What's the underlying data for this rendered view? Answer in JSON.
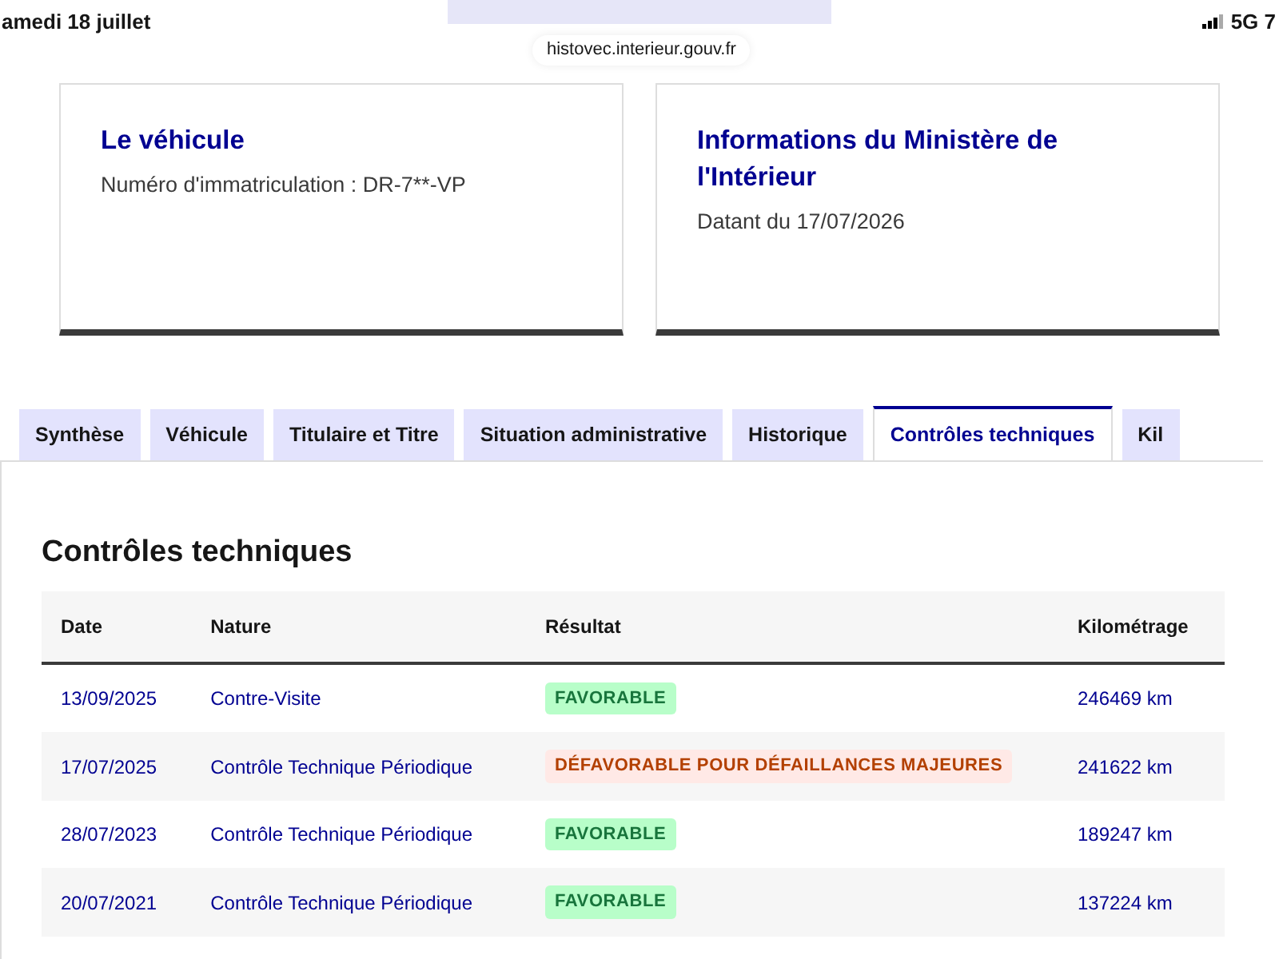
{
  "status_bar": {
    "date": "amedi 18 juillet",
    "network": "5G 7"
  },
  "url": "histovec.interieur.gouv.fr",
  "cards": [
    {
      "title": "Le véhicule",
      "text": "Numéro d'immatriculation : DR-7**-VP"
    },
    {
      "title": "Informations du Ministère de l'Intérieur",
      "text": "Datant du 17/07/2026"
    }
  ],
  "tabs": [
    {
      "label": "Synthèse",
      "selected": false
    },
    {
      "label": "Véhicule",
      "selected": false
    },
    {
      "label": "Titulaire et Titre",
      "selected": false
    },
    {
      "label": "Situation administrative",
      "selected": false
    },
    {
      "label": "Historique",
      "selected": false
    },
    {
      "label": "Contrôles techniques",
      "selected": true
    },
    {
      "label": "Kil",
      "selected": false
    }
  ],
  "section_title": "Contrôles techniques",
  "table": {
    "columns": [
      "Date",
      "Nature",
      "Résultat",
      "Kilométrage"
    ],
    "rows": [
      {
        "date": "13/09/2025",
        "nature": "Contre-Visite",
        "result": {
          "label": "FAVORABLE",
          "kind": "success"
        },
        "mileage": "246469 km"
      },
      {
        "date": "17/07/2025",
        "nature": "Contrôle Technique Périodique",
        "result": {
          "label": "DÉFAVORABLE POUR DÉFAILLANCES MAJEURES",
          "kind": "error"
        },
        "mileage": "241622 km"
      },
      {
        "date": "28/07/2023",
        "nature": "Contrôle Technique Périodique",
        "result": {
          "label": "FAVORABLE",
          "kind": "success"
        },
        "mileage": "189247 km"
      },
      {
        "date": "20/07/2021",
        "nature": "Contrôle Technique Périodique",
        "result": {
          "label": "FAVORABLE",
          "kind": "success"
        },
        "mileage": "137224 km"
      }
    ]
  }
}
